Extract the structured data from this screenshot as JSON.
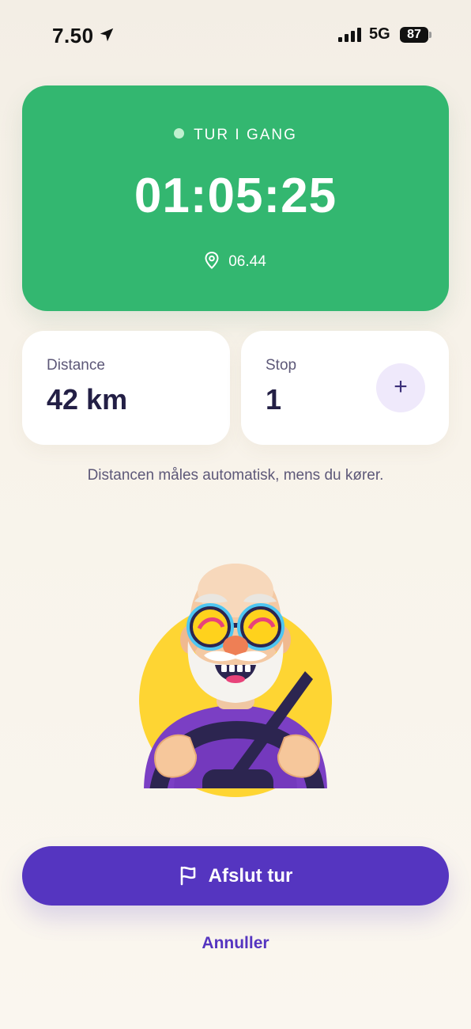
{
  "status_bar": {
    "time": "7.50",
    "network": "5G",
    "battery": "87",
    "icons": [
      "location-arrow-icon",
      "cellular-signal-icon",
      "battery-icon"
    ]
  },
  "trip": {
    "status": "TUR I GANG",
    "timer": "01:05:25",
    "start_time": "06.44",
    "color": "#33b770"
  },
  "stats": {
    "distance": {
      "label": "Distance",
      "value": "42 km"
    },
    "stop": {
      "label": "Stop",
      "value": "1",
      "add_label": "+"
    }
  },
  "hint": "Distancen måles automatisk, mens du kører.",
  "actions": {
    "end_label": "Afslut tur",
    "cancel_label": "Annuller",
    "accent": "#5535c0"
  }
}
